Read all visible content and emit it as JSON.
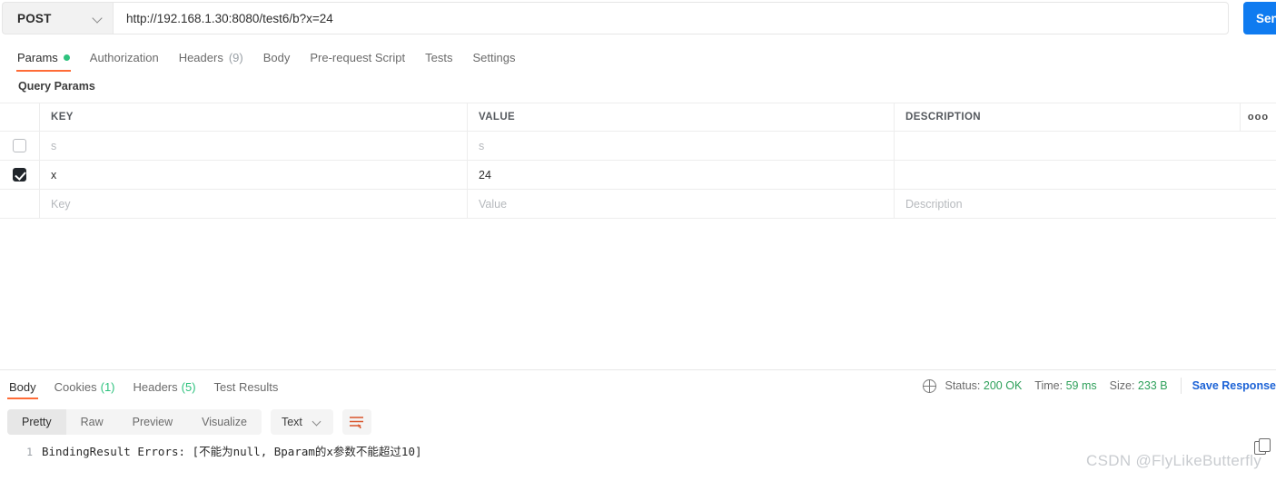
{
  "request": {
    "method": "POST",
    "url": "http://192.168.1.30:8080/test6/b?x=24",
    "send_label": "Send",
    "method_chevron_icon": "chevron-down-icon",
    "tabs": [
      {
        "label": "Params",
        "badge": "dot",
        "active": true
      },
      {
        "label": "Authorization",
        "badge": "",
        "active": false
      },
      {
        "label": "Headers",
        "count": "(9)",
        "active": false
      },
      {
        "label": "Body",
        "badge": "",
        "active": false
      },
      {
        "label": "Pre-request Script",
        "badge": "",
        "active": false
      },
      {
        "label": "Tests",
        "badge": "",
        "active": false
      },
      {
        "label": "Settings",
        "badge": "",
        "active": false
      }
    ]
  },
  "params": {
    "section_title": "Query Params",
    "columns": {
      "key": "KEY",
      "value": "VALUE",
      "description": "DESCRIPTION"
    },
    "more_icon": "ooo",
    "rows": [
      {
        "checked": false,
        "key": "s",
        "key_dim": true,
        "value": "s",
        "value_dim": true,
        "description": ""
      },
      {
        "checked": true,
        "key": "x",
        "key_dim": false,
        "value": "24",
        "value_dim": false,
        "description": ""
      }
    ],
    "new_row": {
      "key_placeholder": "Key",
      "value_placeholder": "Value",
      "description_placeholder": "Description"
    }
  },
  "response": {
    "tabs": [
      {
        "label": "Body",
        "count": "",
        "active": true
      },
      {
        "label": "Cookies",
        "count": "(1)",
        "active": false
      },
      {
        "label": "Headers",
        "count": "(5)",
        "active": false
      },
      {
        "label": "Test Results",
        "count": "",
        "active": false
      }
    ],
    "network_icon": "globe-icon",
    "status_label": "Status:",
    "status_value": "200 OK",
    "time_label": "Time:",
    "time_value": "59 ms",
    "size_label": "Size:",
    "size_value": "233 B",
    "save_response_label": "Save Response",
    "view_modes": [
      {
        "label": "Pretty",
        "active": true
      },
      {
        "label": "Raw",
        "active": false
      },
      {
        "label": "Preview",
        "active": false
      },
      {
        "label": "Visualize",
        "active": false
      }
    ],
    "format_selected": "Text",
    "format_chevron_icon": "chevron-down-icon",
    "wrap_icon": "wrap-text-icon",
    "copy_icon": "copy-icon",
    "body_lines": [
      {
        "number": "1",
        "text": "BindingResult Errors: [不能为null, Bparam的x参数不能超过10]"
      }
    ]
  },
  "watermark": "CSDN @FlyLikeButterfly",
  "colors": {
    "accent_orange": "#ff6c37",
    "send_blue": "#0f7bf0",
    "status_green": "#2ea05a",
    "link_blue": "#1b62d6"
  }
}
